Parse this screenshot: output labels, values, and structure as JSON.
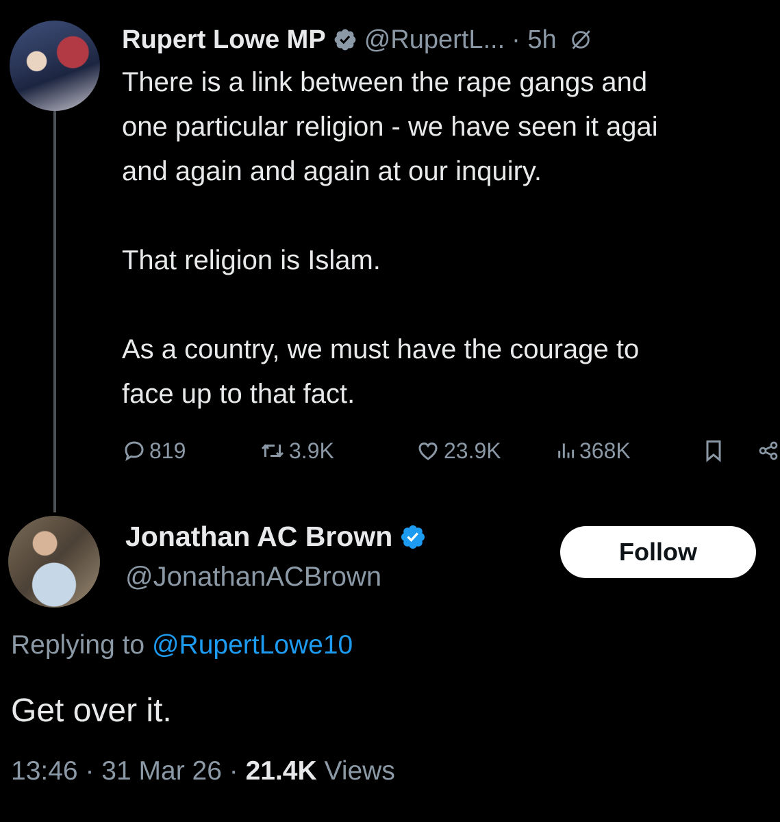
{
  "original_tweet": {
    "author_name": "Rupert Lowe MP",
    "handle": "@RupertL...",
    "time": "· 5h",
    "text_lines": [
      "There is a link between the rape gangs and",
      "one particular religion - we have seen it agai",
      "and again and again at our inquiry.",
      "",
      "That religion is Islam.",
      "",
      "As a country, we must have the courage to",
      "face up to that fact."
    ],
    "actions": {
      "replies": "819",
      "reposts": "3.9K",
      "likes": "23.9K",
      "views": "368K"
    }
  },
  "reply_tweet": {
    "author_name": "Jonathan AC Brown",
    "handle": "@JonathanACBrown",
    "follow_label": "Follow",
    "replying_prefix": "Replying to",
    "replying_to": "@RupertLowe10",
    "text": "Get over it.",
    "time": "13:46",
    "date": "31 Mar 26",
    "views_count": "21.4K",
    "views_label": "Views"
  },
  "colors": {
    "background": "#000000",
    "text": "#e7e9ea",
    "secondary": "#8b98a5",
    "accent": "#1d9bf0",
    "verified": "#1d9bf0"
  },
  "icons": [
    "verified-badge-icon",
    "grok-icon",
    "reply-icon",
    "repost-icon",
    "like-icon",
    "views-icon",
    "bookmark-icon",
    "share-icon"
  ]
}
